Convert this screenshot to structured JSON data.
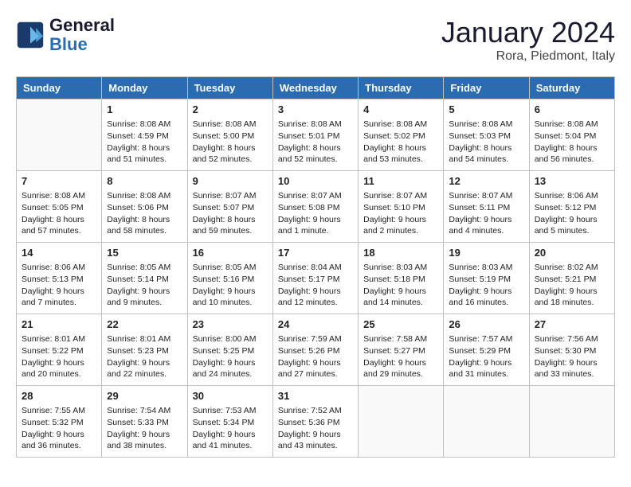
{
  "logo": {
    "line1": "General",
    "line2": "Blue"
  },
  "title": "January 2024",
  "location": "Rora, Piedmont, Italy",
  "days_header": [
    "Sunday",
    "Monday",
    "Tuesday",
    "Wednesday",
    "Thursday",
    "Friday",
    "Saturday"
  ],
  "weeks": [
    [
      {
        "day": "",
        "empty": true
      },
      {
        "day": "1",
        "sunrise": "8:08 AM",
        "sunset": "4:59 PM",
        "daylight": "8 hours and 51 minutes."
      },
      {
        "day": "2",
        "sunrise": "8:08 AM",
        "sunset": "5:00 PM",
        "daylight": "8 hours and 52 minutes."
      },
      {
        "day": "3",
        "sunrise": "8:08 AM",
        "sunset": "5:01 PM",
        "daylight": "8 hours and 52 minutes."
      },
      {
        "day": "4",
        "sunrise": "8:08 AM",
        "sunset": "5:02 PM",
        "daylight": "8 hours and 53 minutes."
      },
      {
        "day": "5",
        "sunrise": "8:08 AM",
        "sunset": "5:03 PM",
        "daylight": "8 hours and 54 minutes."
      },
      {
        "day": "6",
        "sunrise": "8:08 AM",
        "sunset": "5:04 PM",
        "daylight": "8 hours and 56 minutes."
      }
    ],
    [
      {
        "day": "7",
        "sunrise": "8:08 AM",
        "sunset": "5:05 PM",
        "daylight": "8 hours and 57 minutes."
      },
      {
        "day": "8",
        "sunrise": "8:08 AM",
        "sunset": "5:06 PM",
        "daylight": "8 hours and 58 minutes."
      },
      {
        "day": "9",
        "sunrise": "8:07 AM",
        "sunset": "5:07 PM",
        "daylight": "8 hours and 59 minutes."
      },
      {
        "day": "10",
        "sunrise": "8:07 AM",
        "sunset": "5:08 PM",
        "daylight": "9 hours and 1 minute."
      },
      {
        "day": "11",
        "sunrise": "8:07 AM",
        "sunset": "5:10 PM",
        "daylight": "9 hours and 2 minutes."
      },
      {
        "day": "12",
        "sunrise": "8:07 AM",
        "sunset": "5:11 PM",
        "daylight": "9 hours and 4 minutes."
      },
      {
        "day": "13",
        "sunrise": "8:06 AM",
        "sunset": "5:12 PM",
        "daylight": "9 hours and 5 minutes."
      }
    ],
    [
      {
        "day": "14",
        "sunrise": "8:06 AM",
        "sunset": "5:13 PM",
        "daylight": "9 hours and 7 minutes."
      },
      {
        "day": "15",
        "sunrise": "8:05 AM",
        "sunset": "5:14 PM",
        "daylight": "9 hours and 9 minutes."
      },
      {
        "day": "16",
        "sunrise": "8:05 AM",
        "sunset": "5:16 PM",
        "daylight": "9 hours and 10 minutes."
      },
      {
        "day": "17",
        "sunrise": "8:04 AM",
        "sunset": "5:17 PM",
        "daylight": "9 hours and 12 minutes."
      },
      {
        "day": "18",
        "sunrise": "8:03 AM",
        "sunset": "5:18 PM",
        "daylight": "9 hours and 14 minutes."
      },
      {
        "day": "19",
        "sunrise": "8:03 AM",
        "sunset": "5:19 PM",
        "daylight": "9 hours and 16 minutes."
      },
      {
        "day": "20",
        "sunrise": "8:02 AM",
        "sunset": "5:21 PM",
        "daylight": "9 hours and 18 minutes."
      }
    ],
    [
      {
        "day": "21",
        "sunrise": "8:01 AM",
        "sunset": "5:22 PM",
        "daylight": "9 hours and 20 minutes."
      },
      {
        "day": "22",
        "sunrise": "8:01 AM",
        "sunset": "5:23 PM",
        "daylight": "9 hours and 22 minutes."
      },
      {
        "day": "23",
        "sunrise": "8:00 AM",
        "sunset": "5:25 PM",
        "daylight": "9 hours and 24 minutes."
      },
      {
        "day": "24",
        "sunrise": "7:59 AM",
        "sunset": "5:26 PM",
        "daylight": "9 hours and 27 minutes."
      },
      {
        "day": "25",
        "sunrise": "7:58 AM",
        "sunset": "5:27 PM",
        "daylight": "9 hours and 29 minutes."
      },
      {
        "day": "26",
        "sunrise": "7:57 AM",
        "sunset": "5:29 PM",
        "daylight": "9 hours and 31 minutes."
      },
      {
        "day": "27",
        "sunrise": "7:56 AM",
        "sunset": "5:30 PM",
        "daylight": "9 hours and 33 minutes."
      }
    ],
    [
      {
        "day": "28",
        "sunrise": "7:55 AM",
        "sunset": "5:32 PM",
        "daylight": "9 hours and 36 minutes."
      },
      {
        "day": "29",
        "sunrise": "7:54 AM",
        "sunset": "5:33 PM",
        "daylight": "9 hours and 38 minutes."
      },
      {
        "day": "30",
        "sunrise": "7:53 AM",
        "sunset": "5:34 PM",
        "daylight": "9 hours and 41 minutes."
      },
      {
        "day": "31",
        "sunrise": "7:52 AM",
        "sunset": "5:36 PM",
        "daylight": "9 hours and 43 minutes."
      },
      {
        "day": "",
        "empty": true
      },
      {
        "day": "",
        "empty": true
      },
      {
        "day": "",
        "empty": true
      }
    ]
  ]
}
